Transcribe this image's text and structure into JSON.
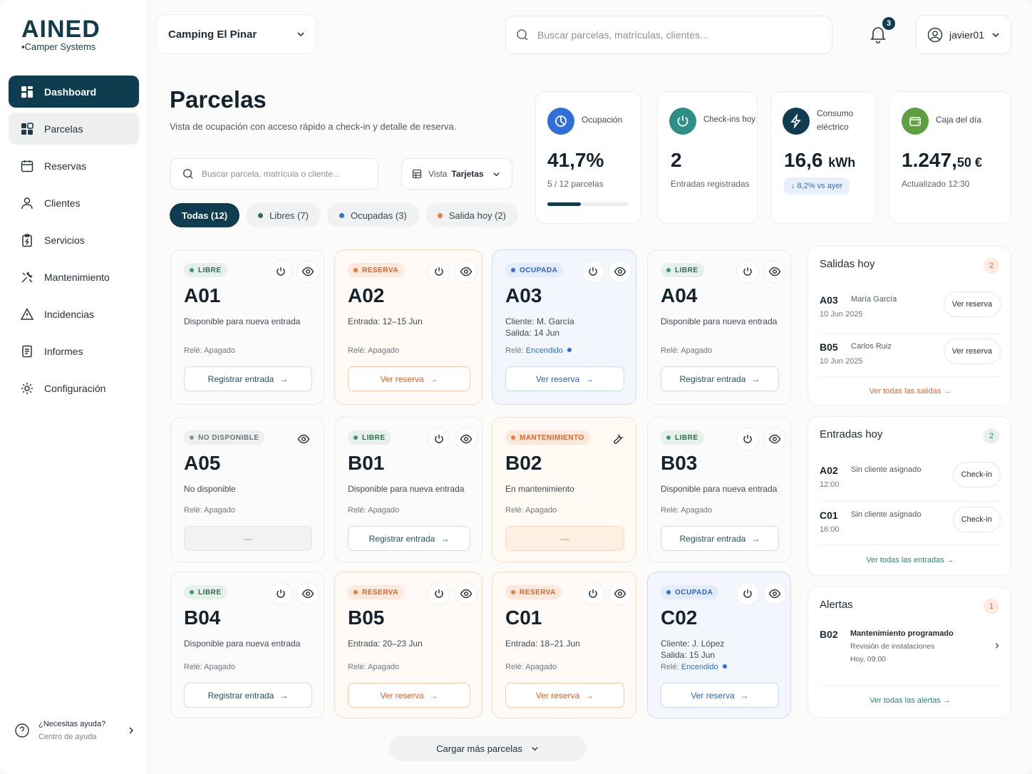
{
  "brand": {
    "name": "AINED",
    "subtitle": "Camper Systems"
  },
  "sidebar": {
    "items": [
      {
        "label": "Dashboard",
        "icon": "grid-icon"
      },
      {
        "label": "Parcelas",
        "icon": "parcel-grid-icon"
      },
      {
        "label": "Reservas",
        "icon": "calendar-icon"
      },
      {
        "label": "Clientes",
        "icon": "user-icon"
      },
      {
        "label": "Servicios",
        "icon": "clipboard-icon"
      },
      {
        "label": "Mantenimiento",
        "icon": "tools-icon"
      },
      {
        "label": "Incidencias",
        "icon": "warning-icon"
      },
      {
        "label": "Informes",
        "icon": "report-icon"
      },
      {
        "label": "Configuración",
        "icon": "gear-icon"
      }
    ],
    "help": {
      "title": "¿Necesitas ayuda?",
      "subtitle": "Centro de ayuda"
    }
  },
  "topbar": {
    "camping": "Camping El Pinar",
    "search_placeholder": "Buscar parcelas, matrículas, clientes...",
    "notifications": "3",
    "user": "javier01"
  },
  "page": {
    "title": "Parcelas",
    "subtitle": "Vista de ocupación con acceso rápido a check-in y detalle de reserva.",
    "filter_placeholder": "Buscar parcela, matrícula o cliente...",
    "view_label": "Vista",
    "view_value": "Tarjetas",
    "chips": [
      {
        "label": "Todas (12)",
        "color": ""
      },
      {
        "label": "Libres (7)",
        "color": "#2f6b53"
      },
      {
        "label": "Ocupadas (3)",
        "color": "#2f6fd8"
      },
      {
        "label": "Salida hoy (2)",
        "color": "#ef7a35"
      }
    ],
    "load_more": "Cargar más parcelas"
  },
  "stats": {
    "ocupacion": {
      "label": "Ocupación",
      "value": "41,7%",
      "note": "5 / 12 parcelas",
      "progress": 0.417
    },
    "checkins": {
      "label": "Check-ins hoy",
      "value": "2",
      "note": "Entradas registradas"
    },
    "consumo": {
      "label": "Consumo eléctrico",
      "value": "16,6",
      "unit": "kWh",
      "delta": "↓ 8,2% vs ayer"
    },
    "caja": {
      "label": "Caja del día",
      "value": "1.247,",
      "cents": "50 €",
      "note": "Actualizado 12:30"
    }
  },
  "parcels": [
    {
      "id": "A01",
      "status": "LIBRE",
      "desc": "Disponible para nueva entrada",
      "rele": "Relé: Apagado",
      "action": "Registrar entrada"
    },
    {
      "id": "A02",
      "status": "RESERVA",
      "desc": "Entrada: 12–15 Jun",
      "rele": "Relé: Apagado",
      "action": "Ver reserva"
    },
    {
      "id": "A03",
      "status": "OCUPADA",
      "desc1": "Cliente:  M. García",
      "desc2": "Salida:   14 Jun",
      "rele": "Relé:",
      "rele_on": "Encendido",
      "action": "Ver reserva"
    },
    {
      "id": "A04",
      "status": "LIBRE",
      "desc": "Disponible para nueva entrada",
      "rele": "Relé: Apagado",
      "action": "Registrar entrada"
    },
    {
      "id": "A05",
      "status": "NO DISPONIBLE",
      "desc": "No disponible",
      "rele": "Relé: Apagado",
      "action": "—"
    },
    {
      "id": "B01",
      "status": "LIBRE",
      "desc": "Disponible para nueva entrada",
      "rele": "Relé: Apagado",
      "action": "Registrar entrada"
    },
    {
      "id": "B02",
      "status": "MANTENIMIENTO",
      "desc": "En mantenimiento",
      "rele": "Relé: Apagado",
      "action": "—"
    },
    {
      "id": "B03",
      "status": "LIBRE",
      "desc": "Disponible para nueva entrada",
      "rele": "Relé: Apagado",
      "action": "Registrar entrada"
    },
    {
      "id": "B04",
      "status": "LIBRE",
      "desc": "Disponible para nueva entrada",
      "rele": "Relé: Apagado",
      "action": "Registrar entrada"
    },
    {
      "id": "B05",
      "status": "RESERVA",
      "desc": "Entrada: 20–23 Jun",
      "rele": "Relé: Apagado",
      "action": "Ver reserva"
    },
    {
      "id": "C01",
      "status": "RESERVA",
      "desc": "Entrada: 18–21 Jun",
      "rele": "Relé: Apagado",
      "action": "Ver reserva"
    },
    {
      "id": "C02",
      "status": "OCUPADA",
      "desc1": "Cliente:  J. López",
      "desc2": "Salida:   15 Jun",
      "rele": "Relé:",
      "rele_on": "Encendido",
      "action": "Ver reserva"
    }
  ],
  "salidas": {
    "title": "Salidas hoy",
    "count": "2",
    "rows": [
      {
        "code": "A03",
        "name": "María García",
        "date": "10 Jun 2025",
        "btn": "Ver reserva"
      },
      {
        "code": "B05",
        "name": "Carlos Ruiz",
        "date": "10 Jun 2025",
        "btn": "Ver reserva"
      }
    ],
    "link": "Ver todas las salidas"
  },
  "entradas": {
    "title": "Entradas hoy",
    "count": "2",
    "rows": [
      {
        "code": "A02",
        "name": "Sin cliente asignado",
        "date": "12:00",
        "btn": "Check-in"
      },
      {
        "code": "C01",
        "name": "Sin cliente asignado",
        "date": "16:00",
        "btn": "Check-in"
      }
    ],
    "link": "Ver todas las entradas"
  },
  "alertas": {
    "title": "Alertas",
    "count": "1",
    "code": "B02",
    "text": "Mantenimiento programado",
    "detail": "Revisión de instalaciones",
    "time": "Hoy, 09:00",
    "link": "Ver todas las alertas"
  },
  "colors": {
    "primary": "#0f3d4f",
    "libre": "#3f9a6b",
    "reserva": "#ef7a35",
    "ocupada": "#2f6fd8"
  }
}
